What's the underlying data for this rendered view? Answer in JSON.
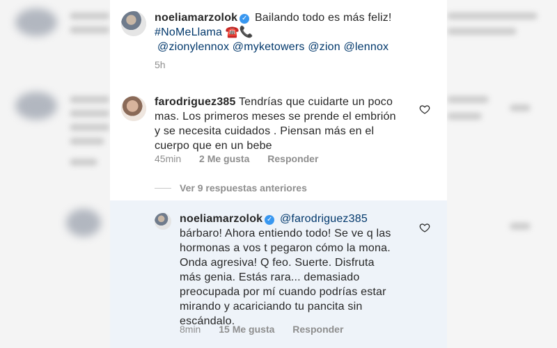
{
  "post": {
    "username": "noeliamarzolok",
    "caption": "Bailando todo es más feliz!",
    "hashtag": "#NoMeLlama",
    "emojis": "☎️📞",
    "mentions": "@zionylennox @myketowers @zion @lennox",
    "time": "5h"
  },
  "comments": [
    {
      "username": "farodriguez385",
      "lines": [
        "Tendrías que cuidarte un poco",
        "mas. Los primeros meses se prende el embrión",
        "y se necesita cuidados . Piensan más en el",
        "cuerpo que en un bebe"
      ],
      "time": "45min",
      "likes": "2 Me gusta",
      "reply_label": "Responder"
    }
  ],
  "view_replies": "Ver 9 respuestas anteriores",
  "reply": {
    "username": "noeliamarzolok",
    "mention": "@farodriguez385",
    "lines": [
      "bárbaro! Ahora entiendo todo! Se ve q las",
      "hormonas a vos t pegaron cómo la mona.",
      "Onda agresiva! Q feo. Suerte.  Disfruta",
      "más genia. Estás rara... demasiado",
      "preocupada por mí cuando podrías estar",
      "mirando y acariciando tu pancita sin",
      "escándalo."
    ],
    "time": "8min",
    "likes": "15 Me gusta",
    "reply_label": "Responder"
  },
  "colors": {
    "text": "#262626",
    "muted": "#8e8e8e",
    "link": "#00376b",
    "verified": "#3897f0",
    "reply_bg": "#eef3f9"
  },
  "icons": {
    "verified": "verified-badge-icon",
    "like": "heart-icon"
  }
}
